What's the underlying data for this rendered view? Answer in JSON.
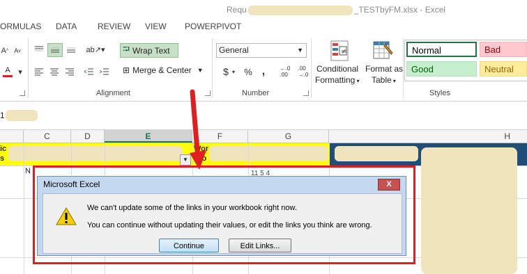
{
  "window": {
    "title_prefix": "Requ",
    "title_suffix": "_TESTbyFM.xlsx - Excel"
  },
  "menu": [
    "ORMULAS",
    "DATA",
    "REVIEW",
    "VIEW",
    "POWERPIVOT"
  ],
  "ribbon": {
    "wrap_text": "Wrap Text",
    "merge_center": "Merge & Center",
    "alignment_label": "Alignment",
    "number_format": "General",
    "number_label": "Number",
    "currency": "$",
    "percent": "%",
    "comma": ",",
    "dec_inc": "←.0\n.00",
    "dec_dec": ".00\n→.0",
    "conditional_formatting": [
      "Conditional",
      "Formatting"
    ],
    "format_as_table": [
      "Format as",
      "Table"
    ],
    "styles_label": "Styles",
    "styles": {
      "normal": "Normal",
      "bad": "Bad",
      "good": "Good",
      "neutral": "Neutral"
    }
  },
  "formula_bar": {
    "name_box": "1"
  },
  "columns": [
    "C",
    "D",
    "E",
    "F",
    "G",
    "H"
  ],
  "cells": {
    "a_header": "ic\ns",
    "f_header": "Wor\nPro",
    "row1_a": "N",
    "row1_g": "11 5 4"
  },
  "dialog": {
    "title": "Microsoft Excel",
    "close": "X",
    "message1": "We can't update some of the links in your workbook right now.",
    "message2": "You can continue without updating their values, or edit the links you think are wrong.",
    "continue_label": "Continue",
    "edit_links_label": "Edit Links..."
  },
  "colors": {
    "accent": "#217346",
    "highlight_yellow": "#ffff00",
    "header_blue": "#1f4e79",
    "annotation_red": "#e02020",
    "style_bad_bg": "#ffc7ce",
    "style_bad_fg": "#9c0006",
    "style_good_bg": "#c6efce",
    "style_good_fg": "#006100",
    "style_neutral_bg": "#ffeb9c",
    "style_neutral_fg": "#9c6500"
  }
}
